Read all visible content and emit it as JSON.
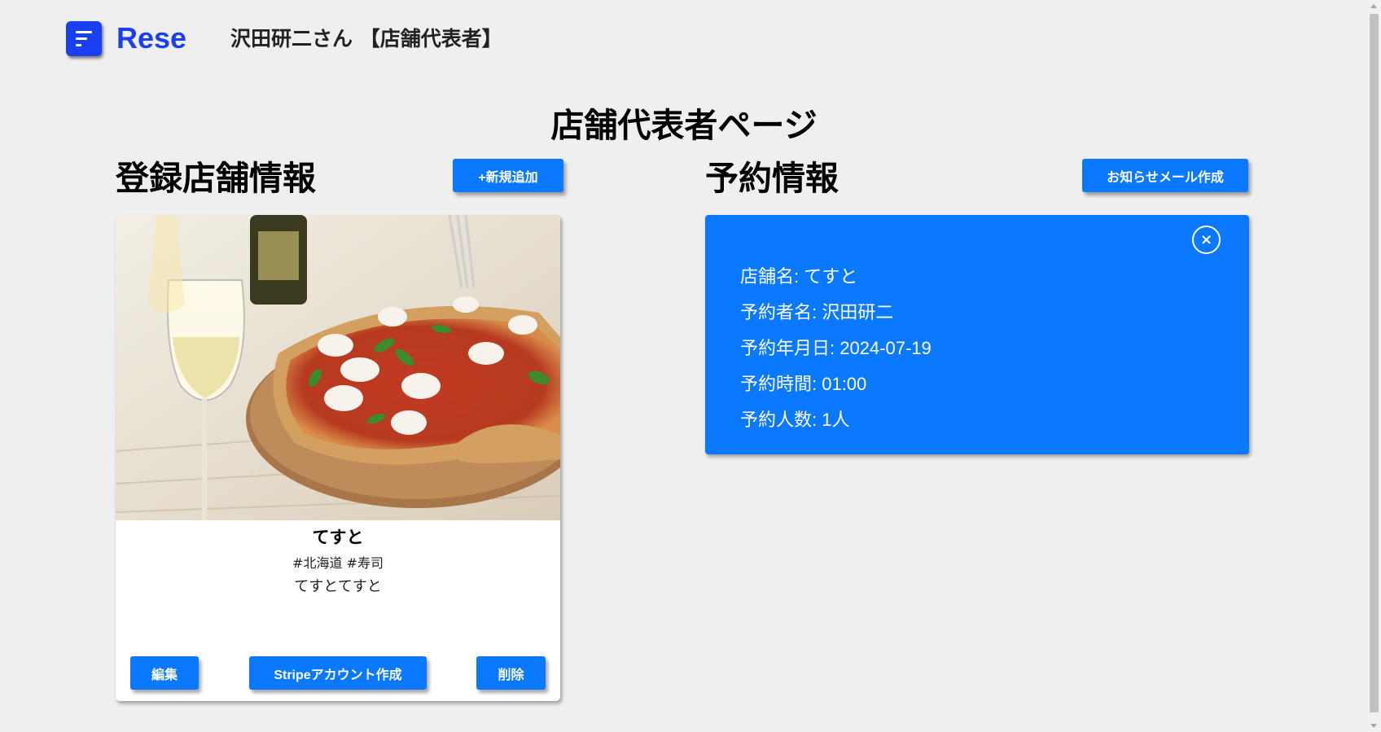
{
  "header": {
    "logo": "Rese",
    "user_name": "沢田研二さん 【店舗代表者】"
  },
  "page": {
    "title": "店舗代表者ページ"
  },
  "shops": {
    "section_title": "登録店舗情報",
    "add_button": "+新規追加",
    "card": {
      "name": "てすと",
      "tags": "#北海道 #寿司",
      "description": "てすとてすと",
      "edit_button": "編集",
      "stripe_button": "Stripeアカウント作成",
      "delete_button": "削除"
    }
  },
  "reservations": {
    "section_title": "予約情報",
    "mail_button": "お知らせメール作成",
    "card": {
      "close_icon": "×",
      "shop": "店舗名: てすと",
      "reserver": "予約者名: 沢田研二",
      "date": "予約年月日: 2024-07-19",
      "time": "予約時間: 01:00",
      "people": "予約人数: 1人"
    }
  },
  "colors": {
    "accent": "#0a78ff",
    "logo": "#1a3ff0",
    "background": "#efefef"
  }
}
